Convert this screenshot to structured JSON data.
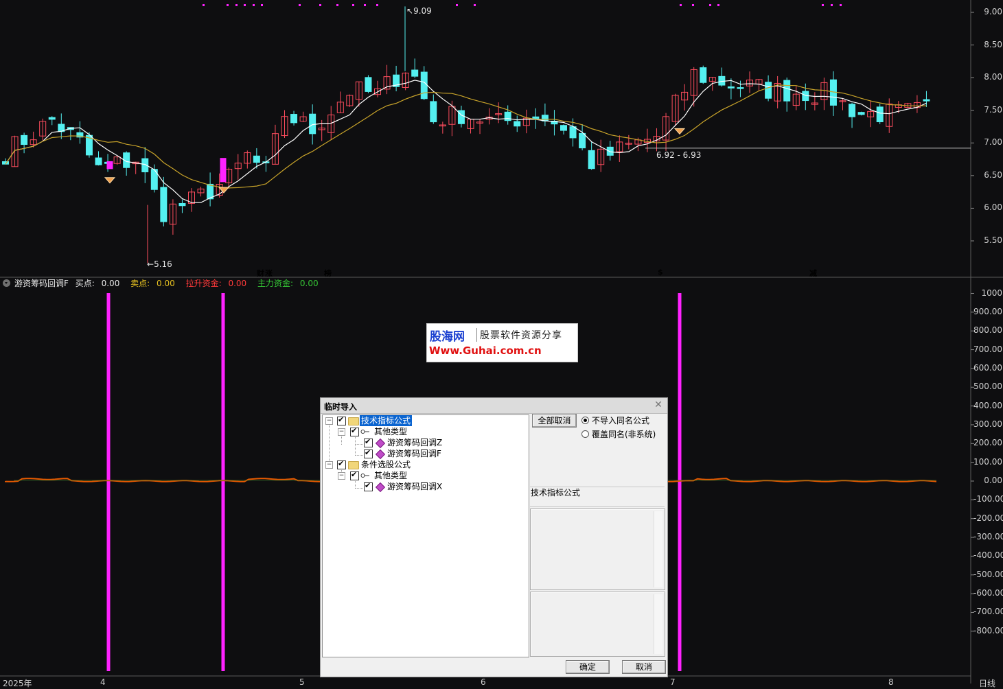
{
  "colors": {
    "background": "#0e0e10",
    "up_candle": "#ff4d5e",
    "down_candle": "#54f0f0",
    "ma_short": "#ffffff",
    "ma_long": "#c9a42a",
    "magenta": "#ff22ff",
    "orange_line": "#e85a00"
  },
  "price_axis": {
    "ticks": [
      "9.09",
      "9.00",
      "8.50",
      "8.00",
      "7.50",
      "7.00",
      "6.50",
      "6.00",
      "5.50"
    ],
    "tick_values": [
      9.0,
      8.5,
      8.0,
      7.5,
      7.0,
      6.5,
      6.0,
      5.5
    ],
    "tick_labels": [
      "9.00",
      "8.50",
      "8.00",
      "7.50",
      "7.00",
      "6.50",
      "6.00",
      "5.50"
    ]
  },
  "price_annotations": {
    "high_label": "9.09",
    "low_label": "5.16",
    "range_label": "6.92 - 6.93"
  },
  "event_tags": [
    {
      "text": "财",
      "color": "#6a8cff"
    },
    {
      "text": "涨",
      "color": "#ff4040"
    },
    {
      "text": "榜",
      "color": "#e0a020"
    },
    {
      "text": "$",
      "color": "#ff3030"
    },
    {
      "text": "减",
      "color": "#3ad03a"
    }
  ],
  "indicator_header": {
    "name": "游资筹码回调F",
    "items": [
      {
        "label": "买点:",
        "value": "0.00",
        "color": "#e6e6e6"
      },
      {
        "label": "卖点:",
        "value": "0.00",
        "color": "#e6c020"
      },
      {
        "label": "拉升资金:",
        "value": "0.00",
        "color": "#ff3a3a"
      },
      {
        "label": "主力资金:",
        "value": "0.00",
        "color": "#36c836"
      }
    ]
  },
  "indicator_axis": {
    "tick_labels": [
      "1000",
      "900.00",
      "800.00",
      "700.00",
      "600.00",
      "500.00",
      "400.00",
      "300.00",
      "200.00",
      "100.00",
      "0.00",
      "-100.00",
      "-200.00",
      "-300.00",
      "-400.00",
      "-500.00",
      "-600.00",
      "-700.00",
      "-800.00"
    ],
    "tick_values": [
      1000,
      900,
      800,
      700,
      600,
      500,
      400,
      300,
      200,
      100,
      0,
      -100,
      -200,
      -300,
      -400,
      -500,
      -600,
      -700,
      -800
    ]
  },
  "watermark": {
    "brand": "股海网",
    "slogan": "股票软件资源分享",
    "url": "Www.Guhai.com.cn"
  },
  "date_axis": {
    "labels": [
      "2025年",
      "4",
      "5",
      "6",
      "7",
      "8",
      "日线"
    ]
  },
  "dialog": {
    "title": "临时导入",
    "tree": [
      {
        "label": "技术指标公式",
        "level": 0,
        "kind": "folder",
        "selected": true
      },
      {
        "label": "其他类型",
        "level": 1,
        "kind": "type"
      },
      {
        "label": "游资筹码回调Z",
        "level": 2,
        "kind": "formula"
      },
      {
        "label": "游资筹码回调F",
        "level": 2,
        "kind": "formula"
      },
      {
        "label": "条件选股公式",
        "level": 0,
        "kind": "folder"
      },
      {
        "label": "其他类型",
        "level": 1,
        "kind": "type"
      },
      {
        "label": "游资筹码回调X",
        "level": 2,
        "kind": "formula"
      }
    ],
    "cancel_all_label": "全部取消",
    "radio_options": [
      {
        "label": "不导入同名公式",
        "checked": true
      },
      {
        "label": "覆盖同名(非系统)",
        "checked": false
      }
    ],
    "category_label": "技术指标公式",
    "ok_label": "确定",
    "cancel_label": "取消"
  }
}
